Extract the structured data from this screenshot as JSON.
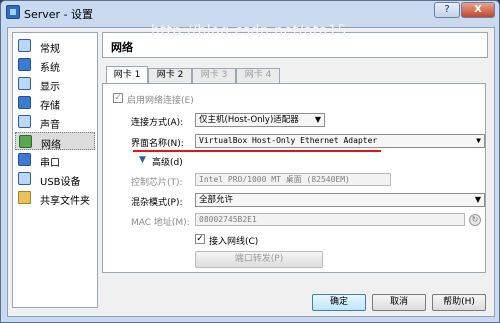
{
  "window": {
    "title": "Server - 设置",
    "help_label": "?",
    "close_label": "X",
    "watermark": "http://blog.csdn.net/ata15"
  },
  "sidebar": {
    "items": [
      {
        "label": "常规",
        "icon": "general-icon"
      },
      {
        "label": "系统",
        "icon": "system-icon"
      },
      {
        "label": "显示",
        "icon": "display-icon"
      },
      {
        "label": "存储",
        "icon": "storage-icon"
      },
      {
        "label": "声音",
        "icon": "audio-icon"
      },
      {
        "label": "网络",
        "icon": "network-icon",
        "selected": true
      },
      {
        "label": "串口",
        "icon": "serial-port-icon"
      },
      {
        "label": "USB设备",
        "icon": "usb-icon"
      },
      {
        "label": "共享文件夹",
        "icon": "shared-folder-icon"
      }
    ]
  },
  "panel": {
    "title": "网络",
    "tabs": [
      {
        "label": "网卡 1",
        "active": true,
        "disabled": false
      },
      {
        "label": "网卡 2",
        "active": false,
        "disabled": false
      },
      {
        "label": "网卡 3",
        "active": false,
        "disabled": true
      },
      {
        "label": "网卡 4",
        "active": false,
        "disabled": true
      }
    ],
    "enable_adapter": {
      "label": "启用网络连接(E)",
      "checked": true
    },
    "attached_to": {
      "label": "连接方式(A):",
      "value": "仅主机(Host-Only)适配器"
    },
    "name": {
      "label": "界面名称(N):",
      "value": "VirtualBox Host-Only Ethernet Adapter"
    },
    "advanced": {
      "label": "高级(d)"
    },
    "adapter_type": {
      "label": "控制芯片(T):",
      "value": "Intel PRO/1000 MT 桌面 (82540EM)"
    },
    "promiscuous": {
      "label": "混杂模式(P):",
      "value": "全部允许"
    },
    "mac": {
      "label": "MAC 地址(M):",
      "value": "08002745B2E1"
    },
    "cable_connected": {
      "label": "接入网线(C)",
      "checked": true
    },
    "port_forwarding": {
      "label": "端口转发(P)"
    }
  },
  "footer": {
    "ok_label": "确定",
    "cancel_label": "取消",
    "help_label": "帮助(H)"
  },
  "colors": {
    "accent_red": "#e01616",
    "selection": "#dcdcdc"
  }
}
